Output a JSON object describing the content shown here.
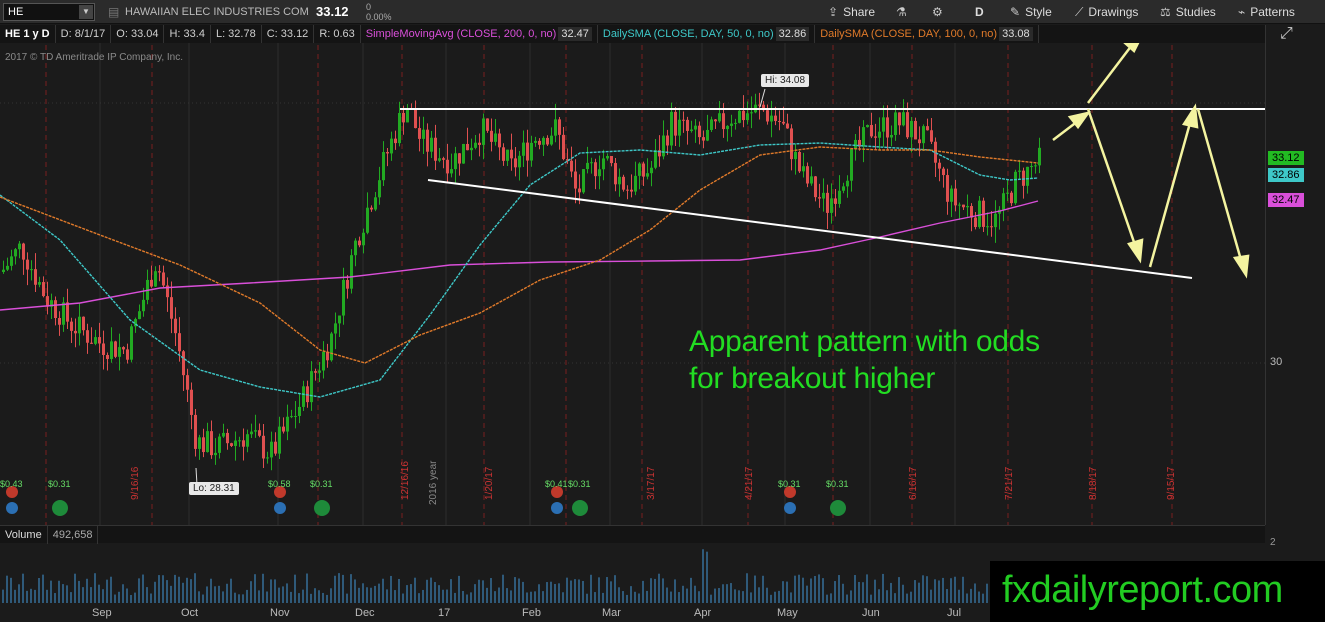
{
  "toolbar": {
    "symbol": "HE",
    "company": "HAWAIIAN ELEC INDUSTRIES COM",
    "last": "33.12",
    "change_top": "0",
    "change_pct": "0.00%",
    "share": "Share",
    "period": "D",
    "style": "Style",
    "drawings": "Drawings",
    "studies": "Studies",
    "patterns": "Patterns"
  },
  "infobar": {
    "title": "HE 1 y D",
    "date": "D: 8/1/17",
    "open": "O: 33.04",
    "high": "H: 33.4",
    "low": "L: 32.78",
    "close": "C: 33.12",
    "range": "R: 0.63",
    "sma200_label": "SimpleMovingAvg (CLOSE, 200, 0, no)",
    "sma200_val": "32.47",
    "sma50_label": "DailySMA (CLOSE, DAY, 50, 0, no)",
    "sma50_val": "32.86",
    "sma100_label": "DailySMA (CLOSE, DAY, 100, 0, no)",
    "sma100_val": "33.08"
  },
  "copyright": "2017 © TD Ameritrade IP Company, Inc.",
  "callouts": {
    "hi": "Hi: 34.08",
    "lo": "Lo: 28.31"
  },
  "price_axis": {
    "label_30": "30",
    "last": "33.12",
    "sma50": "32.86",
    "sma200": "32.47",
    "vol_tick": "2"
  },
  "colors": {
    "sma200": "#d94fd9",
    "sma50": "#3ec8c8",
    "sma100": "#e07a2a",
    "up": "#22aa22",
    "down": "#e05050",
    "annotation": "#22dd22"
  },
  "annotation": {
    "line1": "Apparent pattern with odds",
    "line2": "for breakout higher"
  },
  "volume": {
    "label": "Volume",
    "value": "492,658"
  },
  "months": [
    "Sep",
    "Oct",
    "Nov",
    "Dec",
    "17",
    "Feb",
    "Mar",
    "Apr",
    "May",
    "Jun",
    "Jul"
  ],
  "vdates": [
    "9/16/16",
    "12/16/16",
    "1/20/17",
    "3/17/17",
    "4/21/17",
    "6/16/17",
    "7/21/17",
    "8/18/17",
    "9/15/17"
  ],
  "year_marker": "2016 year",
  "dividends": [
    "$0.43",
    "$0.31",
    "$0.58",
    "$0.31",
    "$0.41",
    "$0.31",
    "$0.31",
    "$0.31"
  ],
  "brand": "fxdailyreport.com",
  "icons": [
    "dropdown-icon",
    "share-icon",
    "flask-icon",
    "gear-icon",
    "style-icon",
    "drawings-icon",
    "studies-icon",
    "patterns-icon",
    "expand-icon"
  ]
}
